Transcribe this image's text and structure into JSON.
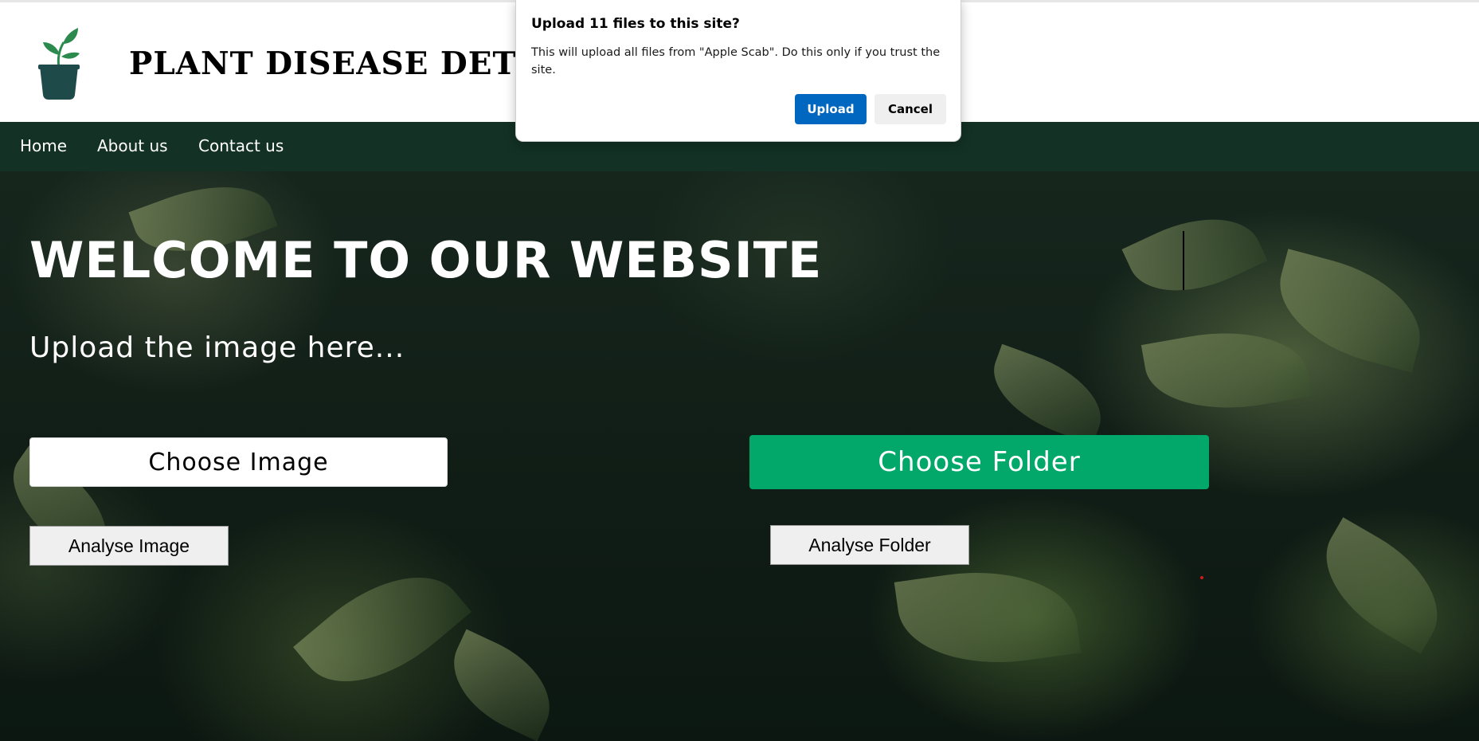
{
  "header": {
    "site_title": "PLANT DISEASE DETECT"
  },
  "nav": {
    "home": "Home",
    "about": "About us",
    "contact": "Contact us"
  },
  "hero": {
    "welcome": "WELCOME TO OUR WEBSITE",
    "subtitle": "Upload the image here...",
    "choose_image": "Choose Image",
    "choose_folder": "Choose Folder",
    "analyse_image": "Analyse Image",
    "analyse_folder": "Analyse Folder"
  },
  "dialog": {
    "title": "Upload 11 files to this site?",
    "message": "This will upload all files from \"Apple Scab\". Do this only if you trust the site.",
    "upload_label": "Upload",
    "cancel_label": "Cancel"
  },
  "colors": {
    "nav_bg": "#133125",
    "folder_button": "#02a86a",
    "dialog_primary": "#0067c0",
    "logo_leaf": "#2d8a4e",
    "logo_pot": "#1f4a4a"
  },
  "icons": {
    "logo": "potted-plant-icon"
  }
}
